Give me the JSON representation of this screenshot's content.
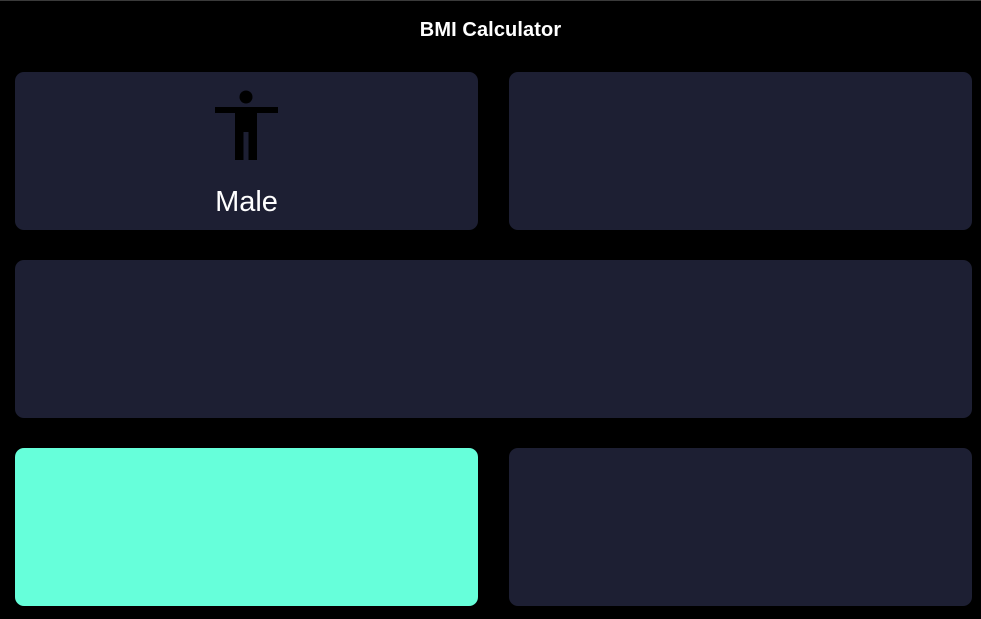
{
  "app": {
    "title": "BMI Calculator"
  },
  "colors": {
    "background": "#000000",
    "card": "#1D1F33",
    "active_card": "#66FFDA",
    "text": "#FFFFFF",
    "icon": "#000000"
  },
  "cards": {
    "male": {
      "label": "Male",
      "icon": "accessibility-icon"
    }
  }
}
